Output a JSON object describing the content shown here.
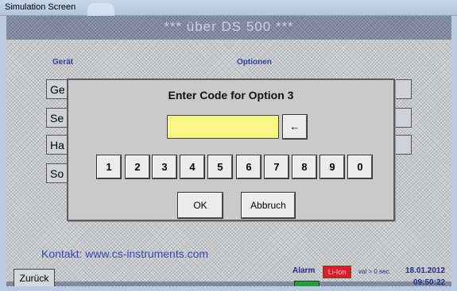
{
  "window": {
    "title": "Simulation Screen"
  },
  "screen": {
    "title": "*** über DS 500 ***"
  },
  "background": {
    "device_label": "Gerät",
    "options_label": "Optionen",
    "left_buttons": [
      "Ge",
      "Se",
      "Ha",
      "So"
    ],
    "right_buttons": [
      "",
      "",
      ""
    ]
  },
  "footer": {
    "contact": "Kontakt: www.cs-instruments.com",
    "back_label": "Zurück",
    "alarm_label": "Alarm",
    "alarm_badge": "Li-Ion",
    "alarm_note": "val > 0 sec.",
    "date": "18.01.2012",
    "time": "09:50:22"
  },
  "dialog": {
    "title": "Enter Code for Option 3",
    "code_value": "",
    "backspace_icon": "←",
    "keys": [
      "1",
      "2",
      "3",
      "4",
      "5",
      "6",
      "7",
      "8",
      "9",
      "0"
    ],
    "ok_label": "OK",
    "cancel_label": "Abbruch"
  },
  "colors": {
    "code_field": "#faf686",
    "alarm_red": "#e01a2a",
    "alarm_green": "#1fa23a",
    "accent_text": "#3348b8"
  }
}
